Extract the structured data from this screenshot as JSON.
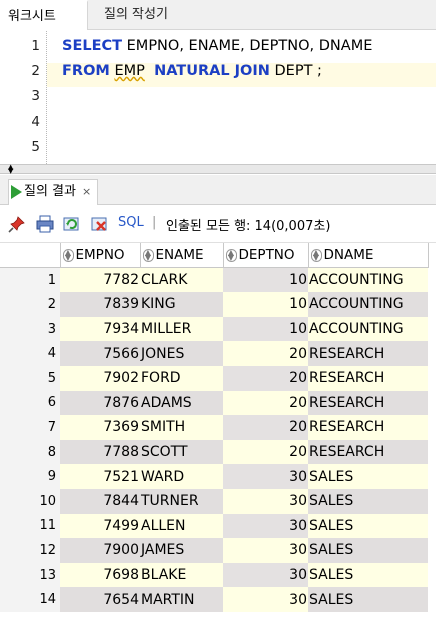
{
  "tabs": [
    {
      "label": "워크시트",
      "active": true
    },
    {
      "label": "질의 작성기",
      "active": false
    }
  ],
  "editor": {
    "line_numbers": [
      "1",
      "2",
      "3",
      "4",
      "5"
    ],
    "line1": {
      "kw": "SELECT",
      "rest": "EMPNO, ENAME, DEPTNO, DNAME"
    },
    "line2": {
      "kw1": "FROM",
      "tbl1": "EMP",
      "kw2": "NATURAL JOIN",
      "tbl2": "DEPT ;"
    }
  },
  "results_panel": {
    "tab_label": "질의 결과",
    "close_label": "×",
    "toolbar": {
      "sql_label": "SQL",
      "separator": "|",
      "status": "인출된 모든 행: 14(0,007초)"
    }
  },
  "grid": {
    "columns": [
      "EMPNO",
      "ENAME",
      "DEPTNO",
      "DNAME"
    ],
    "rows": [
      {
        "n": "1",
        "empno": "7782",
        "ename": "CLARK",
        "deptno": "10",
        "dname": "ACCOUNTING"
      },
      {
        "n": "2",
        "empno": "7839",
        "ename": "KING",
        "deptno": "10",
        "dname": "ACCOUNTING"
      },
      {
        "n": "3",
        "empno": "7934",
        "ename": "MILLER",
        "deptno": "10",
        "dname": "ACCOUNTING"
      },
      {
        "n": "4",
        "empno": "7566",
        "ename": "JONES",
        "deptno": "20",
        "dname": "RESEARCH"
      },
      {
        "n": "5",
        "empno": "7902",
        "ename": "FORD",
        "deptno": "20",
        "dname": "RESEARCH"
      },
      {
        "n": "6",
        "empno": "7876",
        "ename": "ADAMS",
        "deptno": "20",
        "dname": "RESEARCH"
      },
      {
        "n": "7",
        "empno": "7369",
        "ename": "SMITH",
        "deptno": "20",
        "dname": "RESEARCH"
      },
      {
        "n": "8",
        "empno": "7788",
        "ename": "SCOTT",
        "deptno": "20",
        "dname": "RESEARCH"
      },
      {
        "n": "9",
        "empno": "7521",
        "ename": "WARD",
        "deptno": "30",
        "dname": "SALES"
      },
      {
        "n": "10",
        "empno": "7844",
        "ename": "TURNER",
        "deptno": "30",
        "dname": "SALES"
      },
      {
        "n": "11",
        "empno": "7499",
        "ename": "ALLEN",
        "deptno": "30",
        "dname": "SALES"
      },
      {
        "n": "12",
        "empno": "7900",
        "ename": "JAMES",
        "deptno": "30",
        "dname": "SALES"
      },
      {
        "n": "13",
        "empno": "7698",
        "ename": "BLAKE",
        "deptno": "30",
        "dname": "SALES"
      },
      {
        "n": "14",
        "empno": "7654",
        "ename": "MARTIN",
        "deptno": "30",
        "dname": "SALES"
      }
    ]
  },
  "colors": {
    "keyword": "#1c3fc4",
    "row_light": "#ffffe4",
    "row_dark": "#e1dede",
    "run_icon": "#2e9e37",
    "sql_link": "#2858c8"
  },
  "icons": [
    "pin-icon",
    "print-icon",
    "refresh-icon",
    "delete-icon",
    "run-icon",
    "splitter-arrows-icon",
    "sort-icon"
  ]
}
